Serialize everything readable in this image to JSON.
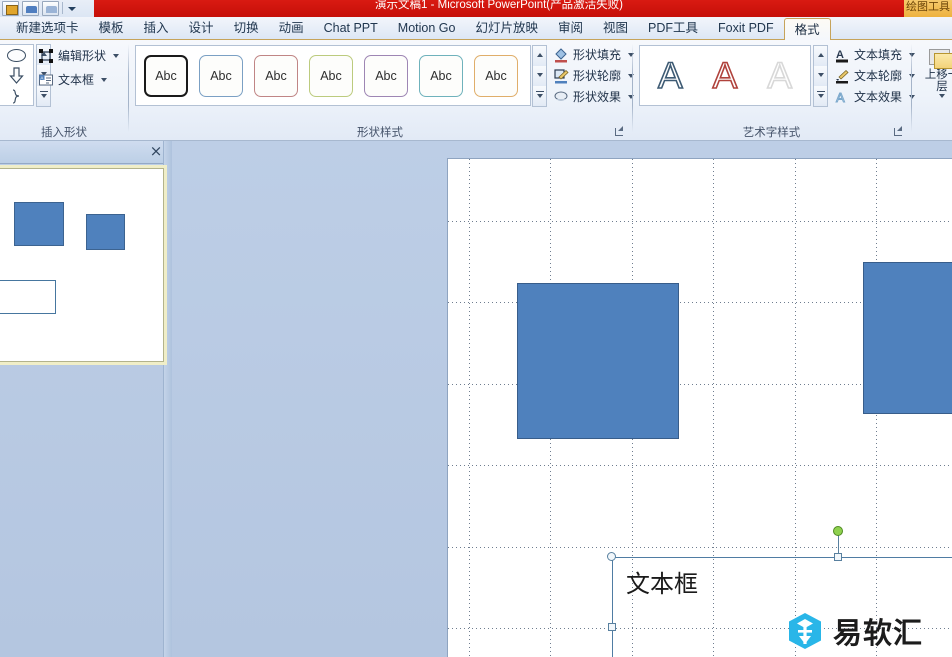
{
  "titlebar": {
    "document_title": "演示文稿1 - Microsoft PowerPoint(产品激活失败)",
    "contextual_tab_top": "绘图工具",
    "qat": [
      {
        "name": "save-icon",
        "label": "保存"
      },
      {
        "name": "undo-icon",
        "label": "撤消"
      },
      {
        "name": "redo-icon",
        "label": "恢复"
      },
      {
        "name": "customize-qat-icon",
        "label": "自定义快速访问工具栏"
      }
    ]
  },
  "tabs": [
    {
      "label": "新建选项卡",
      "active": false
    },
    {
      "label": "模板",
      "active": false
    },
    {
      "label": "插入",
      "active": false
    },
    {
      "label": "设计",
      "active": false
    },
    {
      "label": "切换",
      "active": false
    },
    {
      "label": "动画",
      "active": false
    },
    {
      "label": "Chat PPT",
      "active": false
    },
    {
      "label": "Motion Go",
      "active": false
    },
    {
      "label": "幻灯片放映",
      "active": false
    },
    {
      "label": "审阅",
      "active": false
    },
    {
      "label": "视图",
      "active": false
    },
    {
      "label": "PDF工具",
      "active": false
    },
    {
      "label": "Foxit PDF",
      "active": false
    },
    {
      "label": "格式",
      "active": true
    }
  ],
  "ribbon": {
    "groups": {
      "insert_shapes": {
        "label": "插入形状",
        "buttons": [
          {
            "name": "edit-shape-button",
            "label": "编辑形状"
          },
          {
            "name": "text-box-button",
            "label": "文本框"
          }
        ],
        "shapes": [
          "oval-shape",
          "down-arrow-shape",
          "brace-shape"
        ]
      },
      "shape_styles": {
        "label": "形状样式",
        "thumb_label": "Abc",
        "thumbs": [
          {
            "name": "shape-style-1",
            "border": "#1a1a1a",
            "selected": true
          },
          {
            "name": "shape-style-2",
            "border": "#7ba0c4"
          },
          {
            "name": "shape-style-3",
            "border": "#c08585"
          },
          {
            "name": "shape-style-4",
            "border": "#bccb7e"
          },
          {
            "name": "shape-style-5",
            "border": "#9e86b4"
          },
          {
            "name": "shape-style-6",
            "border": "#6fb2bc"
          },
          {
            "name": "shape-style-7",
            "border": "#e0ae6a"
          }
        ],
        "buttons": [
          {
            "name": "shape-fill-button",
            "label": "形状填充"
          },
          {
            "name": "shape-outline-button",
            "label": "形状轮廓"
          },
          {
            "name": "shape-effects-button",
            "label": "形状效果"
          }
        ]
      },
      "wordart_styles": {
        "label": "艺术字样式",
        "thumb_label": "A",
        "thumbs": [
          {
            "name": "wordart-style-1",
            "color": "#3d5a73"
          },
          {
            "name": "wordart-style-2",
            "color": "#b0423c"
          },
          {
            "name": "wordart-style-3",
            "color": "#d8d8d8"
          }
        ],
        "buttons": [
          {
            "name": "text-fill-button",
            "label": "文本填充"
          },
          {
            "name": "text-outline-button",
            "label": "文本轮廓"
          },
          {
            "name": "text-effects-button",
            "label": "文本效果"
          }
        ]
      },
      "arrange": {
        "bring_forward_label": "上移一层"
      }
    }
  },
  "slide_pane": {
    "close_label": "×",
    "thumbnail": {
      "shapes": [
        {
          "name": "thumb-rect-1",
          "type": "filled"
        },
        {
          "name": "thumb-rect-2",
          "type": "filled"
        },
        {
          "name": "thumb-textbox",
          "type": "outline"
        }
      ]
    }
  },
  "canvas": {
    "shapes": [
      {
        "name": "slide-rect-1",
        "fill": "#4f81bd",
        "stroke": "#385d8a"
      },
      {
        "name": "slide-rect-2",
        "fill": "#4f81bd",
        "stroke": "#385d8a"
      }
    ],
    "textbox": {
      "text": "文本框",
      "selected": true
    }
  },
  "watermark": {
    "text": "易软汇",
    "logo_color": "#29b6e8"
  }
}
